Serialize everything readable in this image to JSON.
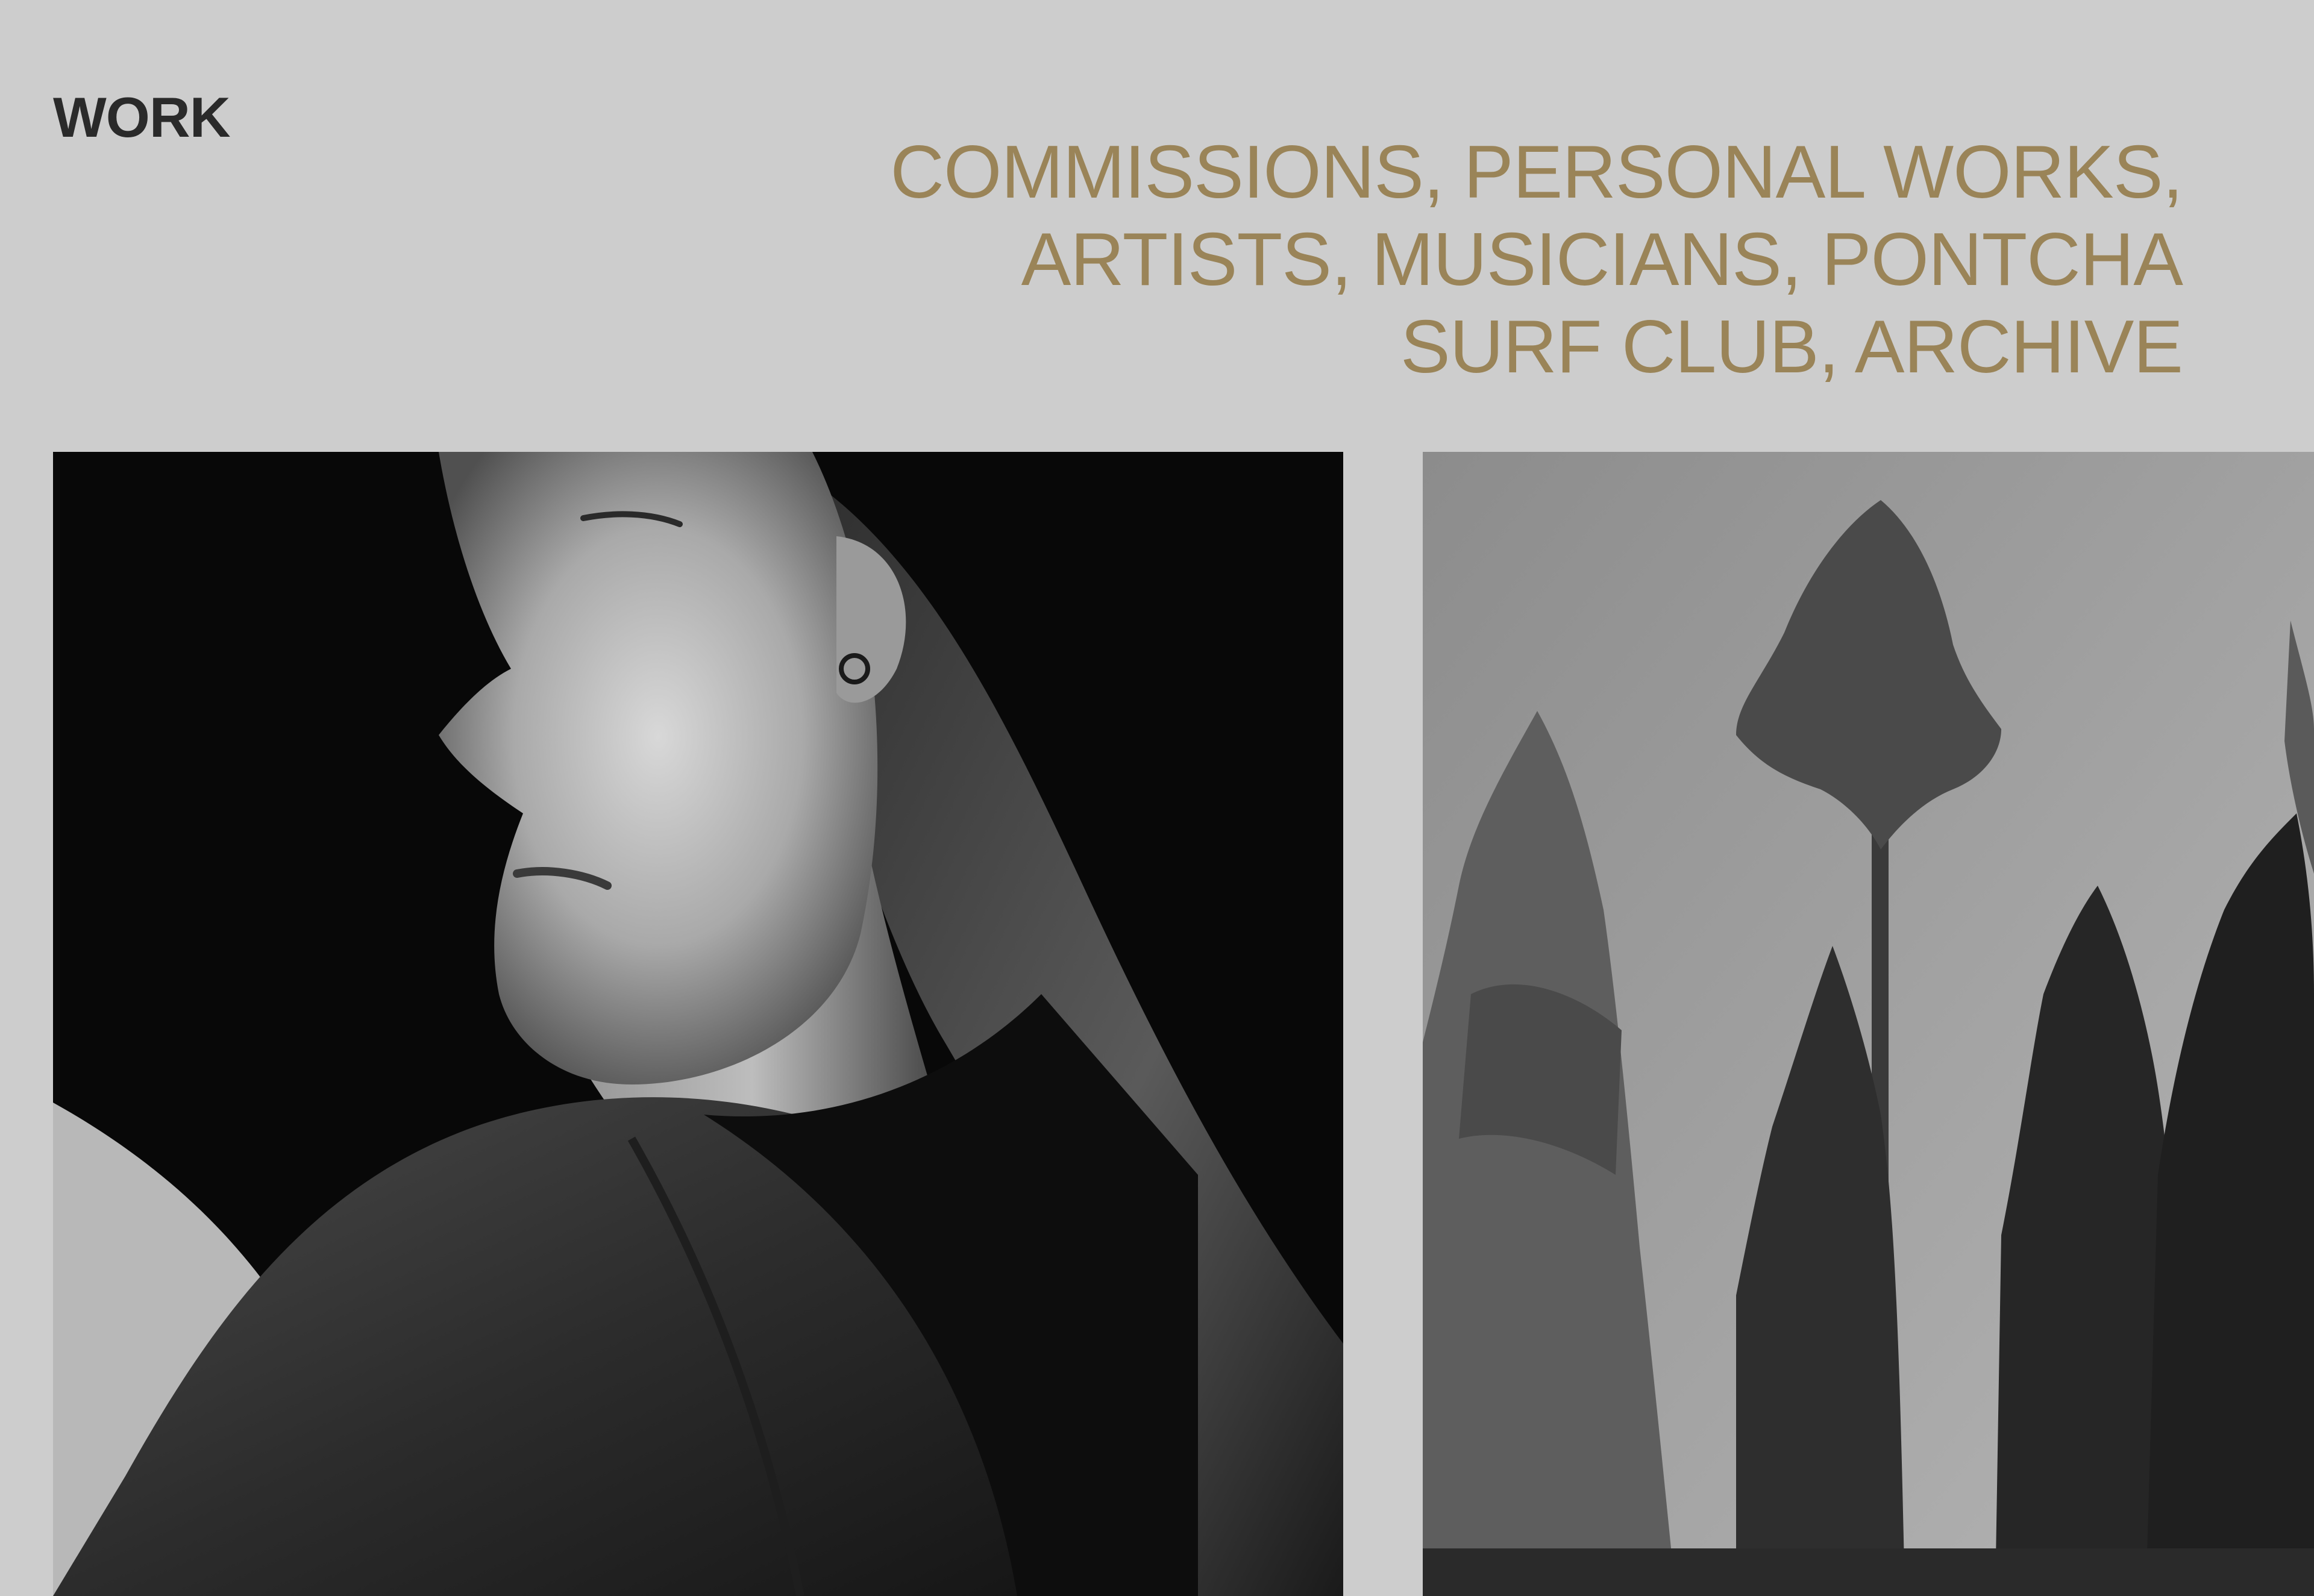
{
  "header": {
    "title": "WORK"
  },
  "categories": [
    {
      "label": "COMMISSIONS",
      "sep": ", "
    },
    {
      "label": "PERSONAL WORKS",
      "sep": ", "
    },
    {
      "label": "ARTISTS",
      "sep": ", "
    },
    {
      "label": "MUSICIANS",
      "sep": ", "
    },
    {
      "label": "PONTCHA SURF CLUB",
      "sep": ", "
    },
    {
      "label": "ARCHIVE",
      "sep": ""
    }
  ],
  "colors": {
    "background": "#cdcdcd",
    "title": "#2a2a2a",
    "accent": "#9a8458"
  },
  "gallery": [
    {
      "subject": "black-and-white portrait of a woman looking over her shoulder"
    },
    {
      "subject": "black-and-white photo of tall pine trees against the sky"
    }
  ]
}
